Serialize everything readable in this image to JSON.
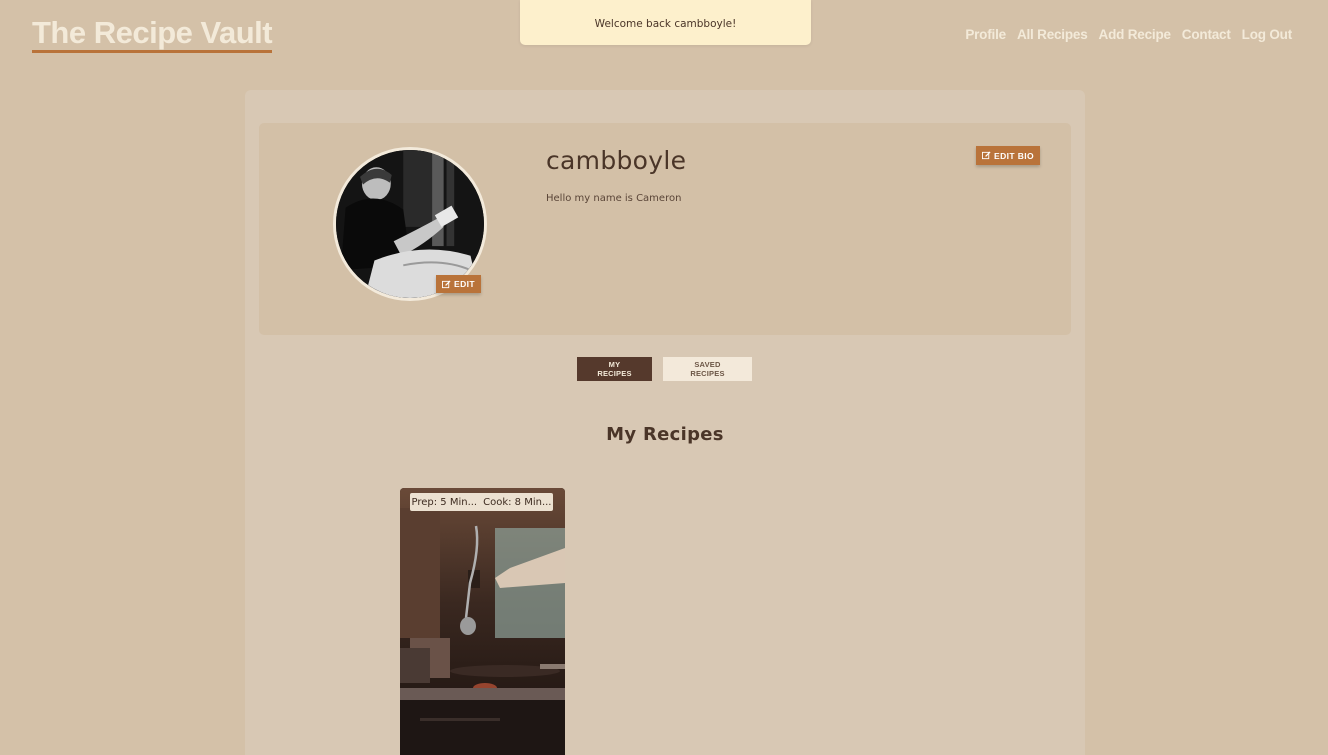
{
  "header": {
    "brand": "The Recipe Vault",
    "nav": [
      "Profile",
      "All Recipes",
      "Add Recipe",
      "Contact",
      "Log Out"
    ]
  },
  "toast": {
    "message": "Welcome back cambboyle!"
  },
  "profile": {
    "username": "cambboyle",
    "bio": "Hello my name is Cameron",
    "edit_avatar_label": "EDIT",
    "edit_bio_label": "EDIT BIO"
  },
  "tabs": [
    {
      "label": "MY RECIPES",
      "active": true
    },
    {
      "label": "SAVED RECIPES",
      "active": false
    }
  ],
  "section_title": "My Recipes",
  "recipes": [
    {
      "prep": "Prep: 5 Min...",
      "cook": "Cook: 8 Min..."
    }
  ],
  "colors": {
    "background": "#d4c1a8",
    "accent": "#b9733a",
    "dark": "#55392c"
  }
}
